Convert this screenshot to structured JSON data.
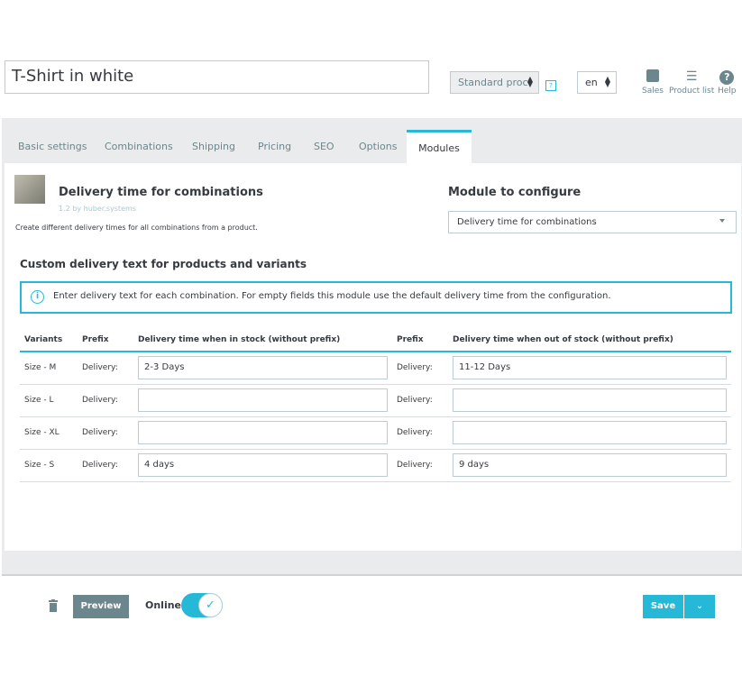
{
  "header": {
    "product_name": "T-Shirt in white",
    "product_type": "Standard proc",
    "help_badge": "?",
    "language": "en",
    "tools": [
      {
        "label": "Sales",
        "icon": "bar-chart-icon"
      },
      {
        "label": "Product list",
        "icon": "list-icon"
      },
      {
        "label": "Help",
        "icon": "help-icon"
      }
    ]
  },
  "tabs": [
    {
      "label": "Basic settings"
    },
    {
      "label": "Combinations"
    },
    {
      "label": "Shipping"
    },
    {
      "label": "Pricing"
    },
    {
      "label": "SEO"
    },
    {
      "label": "Options"
    },
    {
      "label": "Modules",
      "active": true
    }
  ],
  "module": {
    "name": "Delivery time for combinations",
    "version": "1.2 by huber.systems",
    "description": "Create different delivery times for all combinations from a product."
  },
  "configure": {
    "heading": "Module to configure",
    "selected": "Delivery time for combinations"
  },
  "section": {
    "title": "Custom delivery text for products and variants",
    "info": "Enter delivery text for each combination. For empty fields this module use the default delivery time from the configuration."
  },
  "table": {
    "headers": [
      "Variants",
      "Prefix",
      "Delivery time when in stock (without prefix)",
      "Prefix",
      "Delivery time when out of stock (without prefix)"
    ],
    "rows": [
      {
        "variant": "Size - M",
        "prefix1": "Delivery:",
        "in_stock": "2-3 Days",
        "prefix2": "Delivery:",
        "out_stock": "11-12 Days"
      },
      {
        "variant": "Size - L",
        "prefix1": "Delivery:",
        "in_stock": "",
        "prefix2": "Delivery:",
        "out_stock": ""
      },
      {
        "variant": "Size - XL",
        "prefix1": "Delivery:",
        "in_stock": "",
        "prefix2": "Delivery:",
        "out_stock": ""
      },
      {
        "variant": "Size - S",
        "prefix1": "Delivery:",
        "in_stock": "4 days",
        "prefix2": "Delivery:",
        "out_stock": "9 days"
      }
    ]
  },
  "footer": {
    "preview": "Preview",
    "online_label": "Online",
    "online": true,
    "save": "Save"
  },
  "colors": {
    "accent": "#25b9d7",
    "secondary": "#6c868e"
  }
}
